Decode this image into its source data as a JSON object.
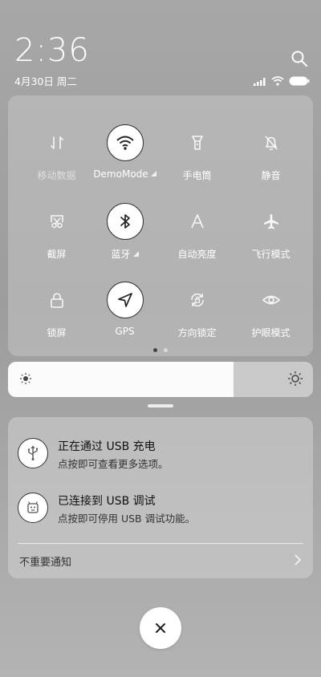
{
  "status_bar": {
    "time": "2:36",
    "date": "4月30日 周二",
    "signal_icon": "signal-icon",
    "wifi_icon": "wifi-icon",
    "battery_icon": "battery-icon"
  },
  "quick_settings": {
    "tiles": [
      {
        "label": "移动数据",
        "icon": "mobile-data-icon",
        "active": false,
        "dimmed": true
      },
      {
        "label": "DemoMode",
        "icon": "wifi-icon",
        "active": true,
        "has_dropdown": true
      },
      {
        "label": "手电筒",
        "icon": "flashlight-icon",
        "active": false
      },
      {
        "label": "静音",
        "icon": "mute-bell-icon",
        "active": false
      },
      {
        "label": "截屏",
        "icon": "screenshot-icon",
        "active": false
      },
      {
        "label": "蓝牙",
        "icon": "bluetooth-icon",
        "active": true,
        "has_dropdown": true
      },
      {
        "label": "自动亮度",
        "icon": "auto-brightness-icon",
        "active": false
      },
      {
        "label": "飞行模式",
        "icon": "airplane-icon",
        "active": false
      },
      {
        "label": "锁屏",
        "icon": "lock-icon",
        "active": false
      },
      {
        "label": "GPS",
        "icon": "location-arrow-icon",
        "active": true
      },
      {
        "label": "方向锁定",
        "icon": "rotation-lock-icon",
        "active": false
      },
      {
        "label": "护眼模式",
        "icon": "eye-icon",
        "active": false
      }
    ],
    "page_count": 2,
    "active_page": 1
  },
  "brightness": {
    "level": 0.74
  },
  "notifications": [
    {
      "title": "正在通过 USB 充电",
      "subtitle": "点按即可查看更多选项。",
      "icon": "usb-icon"
    },
    {
      "title": "已连接到 USB 调试",
      "subtitle": "点按即可停用 USB 调试功能。",
      "icon": "android-debug-icon"
    }
  ],
  "unimportant_label": "不重要通知",
  "colors": {
    "tile_active_bg": "#ffffff",
    "text_light": "#ffffff",
    "accent_red": "#c0392b"
  }
}
